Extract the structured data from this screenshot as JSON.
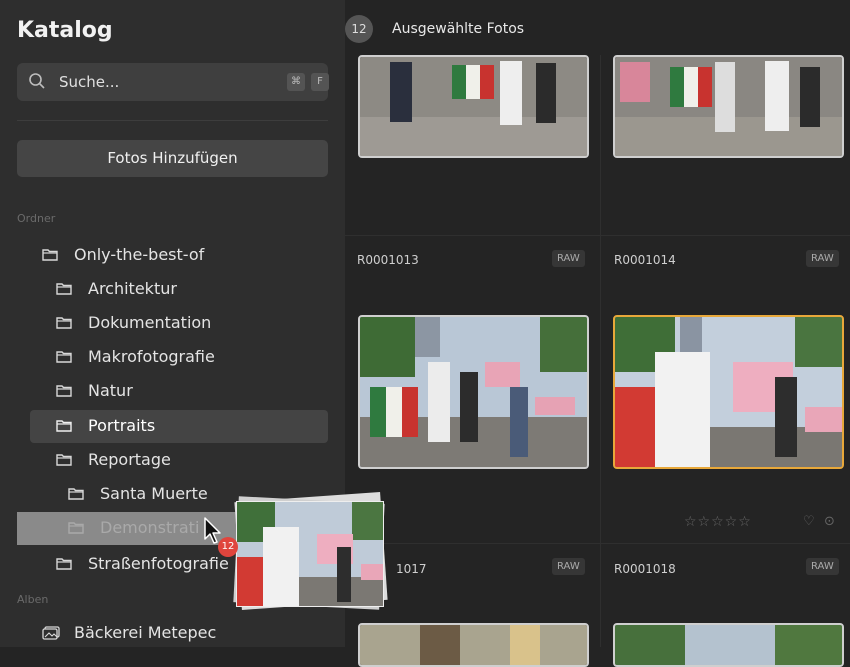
{
  "sidebar": {
    "title": "Katalog",
    "search_placeholder": "Suche...",
    "shortcut_keys": [
      "⌘",
      "F"
    ],
    "add_button": "Fotos Hinzufügen",
    "section_folders": "Ordner",
    "section_albums": "Alben",
    "folders": [
      {
        "label": "Only-the-best-of"
      },
      {
        "label": "Architektur"
      },
      {
        "label": "Dokumentation"
      },
      {
        "label": "Makrofotografie"
      },
      {
        "label": "Natur"
      },
      {
        "label": "Portraits"
      },
      {
        "label": "Reportage"
      },
      {
        "label": "Santa Muerte"
      },
      {
        "label": "Demonstrati"
      },
      {
        "label": "Straßenfotografie"
      }
    ],
    "albums": [
      {
        "label": "Bäckerei Metepec"
      }
    ]
  },
  "topbar": {
    "count": "12",
    "label": "Ausgewählte Fotos"
  },
  "grid": {
    "row2": [
      {
        "filename": "R0001013",
        "format": "RAW"
      },
      {
        "filename": "R0001014",
        "format": "RAW"
      }
    ],
    "row3": [
      {
        "filename": "1017",
        "format": "RAW"
      },
      {
        "filename": "R0001018",
        "format": "RAW"
      }
    ],
    "rating": "☆☆☆☆☆",
    "heart_icon": "♡",
    "more_icon": "⊙"
  },
  "drag": {
    "count": "12"
  },
  "colors": {
    "accent_selected": "#e8a83a",
    "badge": "#e0453d"
  }
}
